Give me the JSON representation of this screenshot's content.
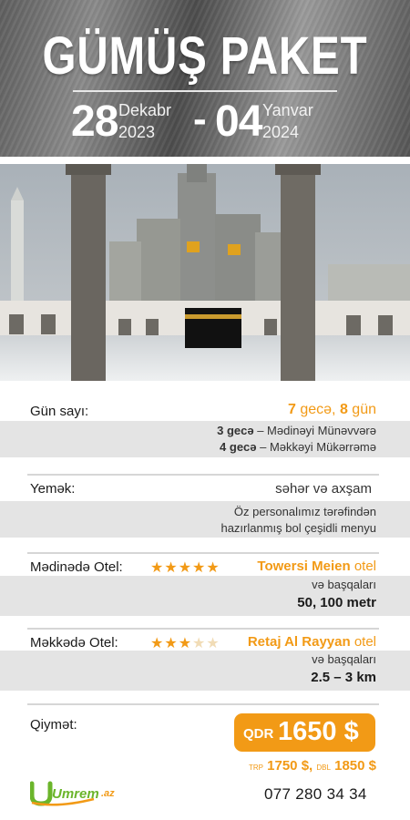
{
  "header": {
    "title": "GÜMÜŞ PAKET",
    "start_day": "28",
    "start_month": "Dekabr",
    "start_year": "2023",
    "dash": "-",
    "end_day": "04",
    "end_month": "Yanvar",
    "end_year": "2024"
  },
  "duration": {
    "label": "Gün sayı:",
    "value_nights_num": "7",
    "value_nights_word": "gecə,",
    "value_days_num": "8",
    "value_days_word": "gün",
    "line1_bold": "3 gecə",
    "line1_rest": " – Mədinəyi Münəvvərə",
    "line2_bold": "4 gecə",
    "line2_rest": " – Məkkəyi Mükərrəmə"
  },
  "food": {
    "label": "Yemək:",
    "value": "səhər və axşam",
    "note_line1": "Öz personalımız tərəfindən",
    "note_line2": "hazırlanmış bol çeşidli menyu"
  },
  "medina_hotel": {
    "label": "Mədinədə Otel:",
    "stars_rating": 5,
    "stars_max": 5,
    "name": "Towersi Meien",
    "suffix": "otel",
    "others": "və başqaları",
    "distance": "50, 100 metr"
  },
  "mecca_hotel": {
    "label": "Məkkədə Otel:",
    "stars_rating": 3,
    "stars_max": 5,
    "name": "Retaj Al Rayyan",
    "suffix": "otel",
    "others": "və başqaları",
    "distance": "2.5 – 3 km"
  },
  "price": {
    "label": "Qiymət:",
    "currency": "QDR",
    "value": "1650 $",
    "trp_label": "TRP",
    "trp_value": "1750 $,",
    "dbl_label": "DBL",
    "dbl_value": "1850 $"
  },
  "footer": {
    "logo_main": "Umrem",
    "logo_suffix": ".az",
    "phone": "077 280 34 34"
  },
  "colors": {
    "accent": "#f29a16",
    "band": "#e4e4e4",
    "logo_green": "#6bb52b"
  }
}
